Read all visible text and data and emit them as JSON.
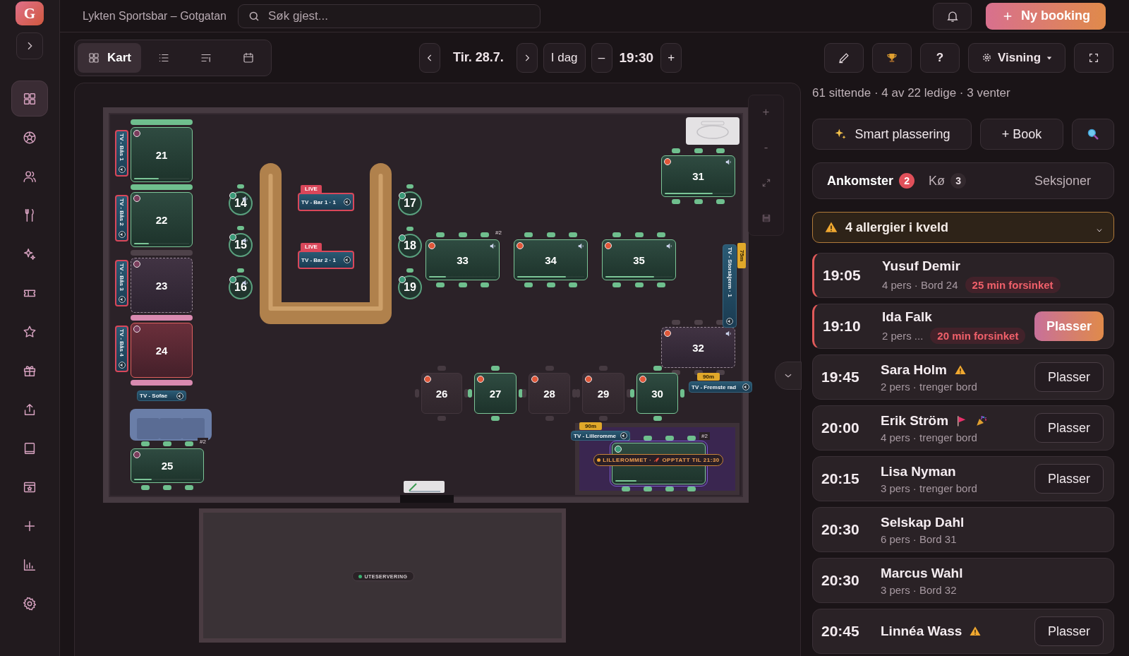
{
  "header": {
    "logo": "G",
    "title": "Lykten Sportsbar – Gotgatan",
    "search": {
      "placeholder": "Søk gjest..."
    },
    "new_booking": "Ny booking"
  },
  "sidebar": {
    "items": [
      {
        "selected": true
      },
      {
        "selected": false
      },
      {
        "selected": false
      },
      {
        "selected": false
      },
      {
        "selected": false
      },
      {
        "selected": false
      },
      {
        "selected": false
      },
      {
        "selected": false
      },
      {
        "selected": false
      },
      {
        "selected": false
      },
      {
        "selected": false
      },
      {
        "selected": false
      },
      {
        "selected": false
      },
      {
        "selected": false
      }
    ]
  },
  "toolbar": {
    "views": [
      {
        "label": "Kart",
        "selected": true
      },
      {
        "selected": false
      },
      {
        "selected": false
      },
      {
        "selected": false
      }
    ],
    "date": "Tir. 28.7.",
    "today": "I dag",
    "minus": "–",
    "time": "19:30",
    "plus": "+",
    "help": "?",
    "view_menu": "Visning"
  },
  "map": {
    "controls": {
      "zoom_in": "+",
      "zoom_out": "-"
    },
    "tables": [
      {
        "number": "21",
        "kind": "booth",
        "occupied": true,
        "reserved": false,
        "late": false,
        "color": "#7a3d5c",
        "level": 0.45,
        "audio": false
      },
      {
        "number": "22",
        "kind": "booth",
        "occupied": true,
        "reserved": false,
        "late": false,
        "color": "#7a3d5c",
        "level": 0.27,
        "audio": false
      },
      {
        "number": "23",
        "kind": "booth",
        "occupied": false,
        "reserved": true,
        "late": false,
        "color": "#7a3d5c",
        "audio": false
      },
      {
        "number": "24",
        "kind": "booth",
        "occupied": false,
        "reserved": false,
        "late": true,
        "color": "#7a3d5c",
        "audio": false
      },
      {
        "number": "25",
        "kind": "rect",
        "occupied": true,
        "reserved": false,
        "late": false,
        "color": "#7a3d5c",
        "level": 0.27,
        "audio": false,
        "tag": "#2"
      },
      {
        "number": "14",
        "kind": "round",
        "occupied": true,
        "reserved": false,
        "late": false,
        "color": "#3a9a78",
        "audio": true
      },
      {
        "number": "15",
        "kind": "round",
        "occupied": true,
        "reserved": false,
        "late": false,
        "color": "#3a9a78",
        "audio": true
      },
      {
        "number": "16",
        "kind": "round",
        "occupied": true,
        "reserved": false,
        "late": false,
        "color": "#3a9a78",
        "audio": true
      },
      {
        "number": "17",
        "kind": "round",
        "occupied": true,
        "reserved": false,
        "late": false,
        "color": "#3a9a78",
        "audio": false
      },
      {
        "number": "18",
        "kind": "round",
        "occupied": true,
        "reserved": false,
        "late": false,
        "color": "#3a9a78",
        "audio": false
      },
      {
        "number": "19",
        "kind": "round",
        "occupied": true,
        "reserved": false,
        "late": false,
        "color": "#3a9a78",
        "audio": false
      },
      {
        "number": "33",
        "kind": "rect",
        "occupied": true,
        "reserved": false,
        "late": false,
        "color": "#e0583a",
        "level": 0.25,
        "audio": true,
        "tag": "#2"
      },
      {
        "number": "34",
        "kind": "rect",
        "occupied": true,
        "reserved": false,
        "late": false,
        "color": "#e0583a",
        "level": 0.73,
        "audio": true
      },
      {
        "number": "35",
        "kind": "rect",
        "occupied": true,
        "reserved": false,
        "late": false,
        "color": "#e0583a",
        "level": 0.73,
        "audio": true
      },
      {
        "number": "31",
        "kind": "rect",
        "occupied": true,
        "reserved": false,
        "late": false,
        "color": "#e0583a",
        "level": 0.72,
        "audio": true
      },
      {
        "number": "32",
        "kind": "rect",
        "occupied": false,
        "reserved": true,
        "late": false,
        "color": "#e0583a",
        "audio": true
      },
      {
        "number": "26",
        "kind": "square",
        "occupied": false,
        "reserved": false,
        "late": false,
        "color": "#e0583a",
        "audio": false
      },
      {
        "number": "27",
        "kind": "square",
        "occupied": true,
        "reserved": false,
        "late": false,
        "color": "#e0583a",
        "audio": false
      },
      {
        "number": "28",
        "kind": "square",
        "occupied": false,
        "reserved": false,
        "late": false,
        "color": "#e0583a",
        "audio": false
      },
      {
        "number": "29",
        "kind": "square",
        "occupied": false,
        "reserved": false,
        "late": false,
        "color": "#e0583a",
        "audio": false
      },
      {
        "number": "30",
        "kind": "square",
        "occupied": true,
        "reserved": false,
        "late": false,
        "color": "#e0583a",
        "audio": false
      },
      {
        "kind": "long",
        "occupied": true,
        "reserved": false,
        "late": false,
        "color": "#3a9a78",
        "level": 0.24,
        "audio": false,
        "tag": "#2"
      }
    ],
    "tvs": [
      {
        "label": "TV - Bås 1",
        "vertical": true,
        "highlighted": true
      },
      {
        "label": "TV - Bås 2",
        "vertical": true,
        "highlighted": true
      },
      {
        "label": "TV - Bås 3",
        "vertical": true,
        "highlighted": true
      },
      {
        "label": "TV - Bås 4",
        "vertical": true,
        "highlighted": true
      },
      {
        "label": "TV - Sofae",
        "vertical": false,
        "highlighted": false
      },
      {
        "label": "TV - Bar 1 · 1",
        "vertical": false,
        "highlighted": true,
        "badge": "LIVE"
      },
      {
        "label": "TV - Bar 2 · 1",
        "vertical": false,
        "highlighted": true,
        "badge": "LIVE"
      },
      {
        "label": "TV - Storskjerm · 1",
        "vertical": true,
        "highlighted": false,
        "timer": "75m"
      },
      {
        "label": "TV - Fremste rad",
        "vertical": false,
        "highlighted": false,
        "timer": "90m"
      },
      {
        "label": "TV - Lilleromme",
        "vertical": false,
        "highlighted": false,
        "timer": "90m"
      }
    ],
    "room_label": {
      "room": "LILLEROMMET ·",
      "status": "OPPTATT TIL 21:30"
    },
    "outdoor": "UTESERVERING"
  },
  "panel": {
    "stats": "61 sittende · 4 av 22 ledige · 3 venter",
    "smart": "Smart plassering",
    "book": "+ Book",
    "tabs": [
      {
        "label": "Ankomster",
        "count": "2",
        "selected": true
      },
      {
        "label": "Kø",
        "count": "3",
        "selected": false
      },
      {
        "label": "Seksjoner",
        "selected": false
      }
    ],
    "alert": "4 allergier i kveld",
    "arrivals": [
      {
        "time": "19:05",
        "name": "Yusuf Demir",
        "warning": false,
        "flag": false,
        "party": false,
        "details": "4 pers · Bord 24",
        "delay": "25 min forsinket",
        "late": true
      },
      {
        "time": "19:10",
        "name": "Ida Falk",
        "warning": false,
        "flag": false,
        "party": false,
        "details": "2 pers ...",
        "delay": "20 min forsinket",
        "late": true,
        "button": "Plasser",
        "primary": true
      },
      {
        "time": "19:45",
        "name": "Sara Holm",
        "warning": true,
        "flag": false,
        "party": false,
        "details": "2 pers · trenger bord",
        "late": false,
        "button": "Plasser",
        "primary": false
      },
      {
        "time": "20:00",
        "name": "Erik Ström",
        "warning": false,
        "flag": true,
        "party": true,
        "details": "4 pers · trenger bord",
        "late": false,
        "button": "Plasser",
        "primary": false
      },
      {
        "time": "20:15",
        "name": "Lisa Nyman",
        "warning": false,
        "flag": false,
        "party": false,
        "details": "3 pers · trenger bord",
        "late": false,
        "button": "Plasser",
        "primary": false
      },
      {
        "time": "20:30",
        "name": "Selskap Dahl",
        "warning": false,
        "flag": false,
        "party": false,
        "details": "6 pers · Bord 31",
        "late": false
      },
      {
        "time": "20:30",
        "name": "Marcus Wahl",
        "warning": false,
        "flag": false,
        "party": false,
        "details": "3 pers · Bord 32",
        "late": false
      },
      {
        "time": "20:45",
        "name": "Linnéa Wass",
        "warning": true,
        "flag": false,
        "party": false,
        "late": false,
        "button": "Plasser",
        "primary": false
      }
    ]
  }
}
